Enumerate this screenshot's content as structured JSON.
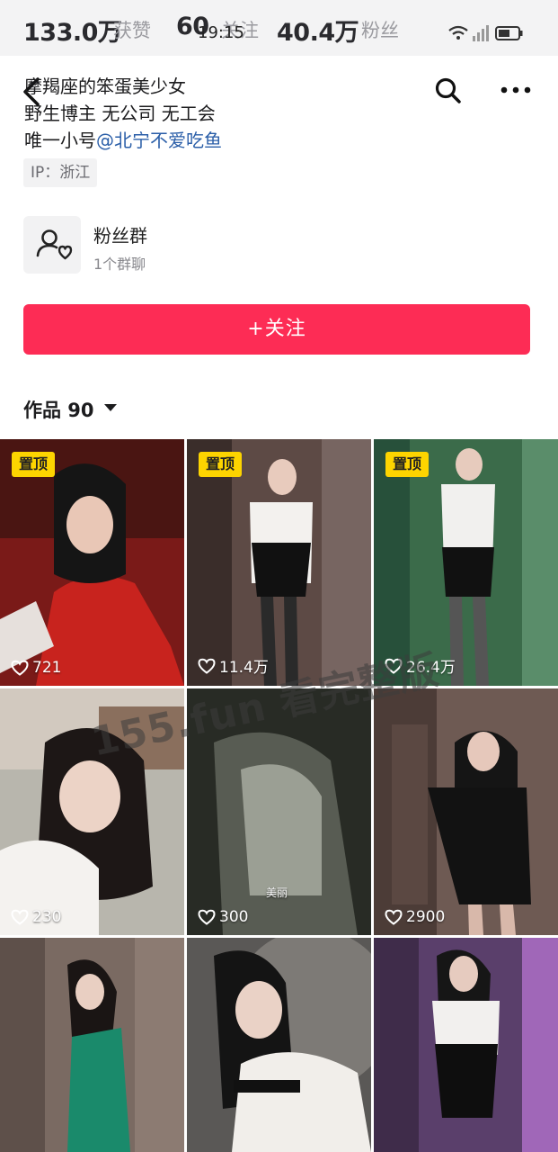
{
  "status_bar": {
    "time": "19:15",
    "icons": [
      "wifi-icon",
      "signal-icon",
      "battery-icon"
    ]
  },
  "stats": [
    {
      "value": "133.0万",
      "label": "获赞"
    },
    {
      "value": "60",
      "label": "关注"
    },
    {
      "value": "40.4万",
      "label": "粉丝"
    }
  ],
  "nav": {
    "icons": [
      "back-icon",
      "search-icon",
      "more-icon"
    ]
  },
  "bio": {
    "line1": "摩羯座的笨蛋美少女",
    "line2": "野生博主 无公司 无工会",
    "line3_prefix": "唯一小号",
    "line3_handle": "@北宁不爱吃鱼",
    "ip_tag": "IP：浙江"
  },
  "fan_group": {
    "title": "粉丝群",
    "subtitle": "1个群聊",
    "icon": "fan-group-icon"
  },
  "follow_button": {
    "label": "+关注"
  },
  "works": {
    "label": "作品 90"
  },
  "videos": [
    {
      "pinned": true,
      "pin_label": "置顶",
      "likes": "721"
    },
    {
      "pinned": true,
      "pin_label": "置顶",
      "likes": "11.4万"
    },
    {
      "pinned": true,
      "pin_label": "置顶",
      "likes": "26.4万"
    },
    {
      "pinned": false,
      "likes": "230"
    },
    {
      "pinned": false,
      "likes": "300",
      "caption": "美丽"
    },
    {
      "pinned": false,
      "likes": "2900"
    },
    {
      "pinned": false
    },
    {
      "pinned": false
    },
    {
      "pinned": false
    }
  ],
  "watermark": "155.fun 看完整版",
  "colors": {
    "accent": "#fd2c55",
    "pin": "#fdd400",
    "handle": "#2a5ea8"
  }
}
